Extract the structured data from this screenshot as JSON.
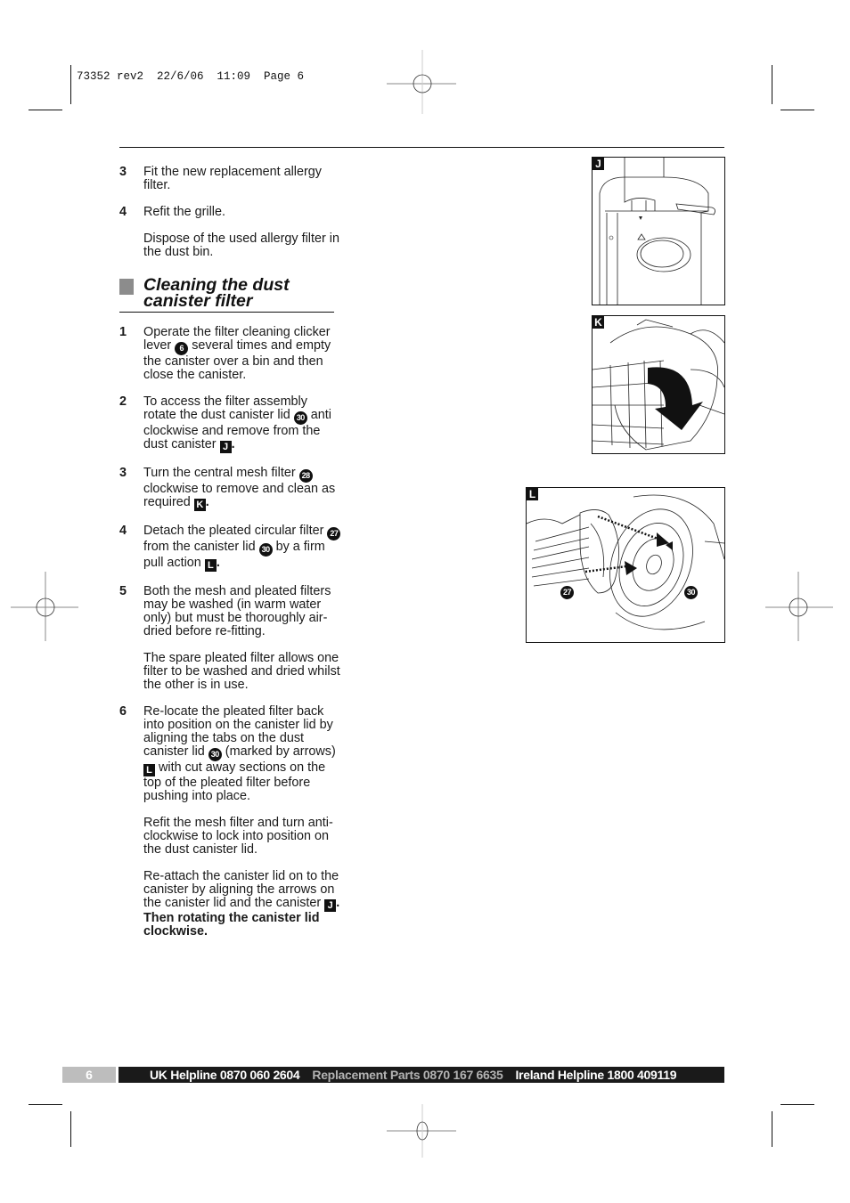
{
  "slug": "73352 rev2  22/6/06  11:09  Page 6",
  "intro_steps": [
    {
      "num": "3",
      "text": "Fit the new replacement allergy filter."
    },
    {
      "num": "4",
      "text": "Refit the grille."
    }
  ],
  "intro_note": "Dispose of the used allergy filter in the dust bin.",
  "section": {
    "heading": "Cleaning the dust canister filter",
    "steps": [
      {
        "num": "1",
        "parts": [
          "Operate the filter cleaning clicker lever ",
          "6",
          " several times and empty the canister over a bin and then close the canister."
        ]
      },
      {
        "num": "2",
        "parts": [
          "To access the filter assembly rotate the dust canister lid ",
          "30",
          " anti clockwise and remove from the dust canister ",
          "J",
          "."
        ]
      },
      {
        "num": "3",
        "parts": [
          "Turn the central mesh filter ",
          "28",
          " clockwise to remove and clean as required ",
          "K",
          "."
        ]
      },
      {
        "num": "4",
        "parts": [
          "Detach the pleated circular filter ",
          "27",
          " from the canister lid ",
          "30",
          " by a firm pull action ",
          "L",
          "."
        ]
      },
      {
        "num": "5",
        "text": "Both the mesh and pleated filters may be washed (in warm water only) but must be thoroughly air-dried before re-fitting."
      },
      {
        "num": "6",
        "parts": [
          "Re-locate the pleated filter back into position on the canister lid by aligning the tabs on the dust canister lid ",
          "30",
          " (marked by arrows) ",
          "L",
          " with cut away sections on the top of the pleated filter before pushing into place."
        ]
      }
    ],
    "note_after_5": "The spare pleated filter allows one filter to be washed and dried whilst the other is in use.",
    "note_after_6a": "Refit the mesh filter and turn anti-clockwise to lock into position on the dust canister lid.",
    "note_after_6b": [
      "Re-attach the canister lid on to the canister by aligning the arrows on the canister lid and the canister ",
      "J",
      ". Then rotating the canister lid clockwise."
    ]
  },
  "figures": {
    "j": {
      "label": "J"
    },
    "k": {
      "label": "K"
    },
    "l": {
      "label": "L",
      "callouts": [
        "27",
        "30"
      ]
    }
  },
  "footer": {
    "page_number": "6",
    "uk_helpline": "UK Helpline 0870 060 2604",
    "replacement_parts": "Replacement Parts 0870 167 6635",
    "ireland_helpline": "Ireland Helpline 1800 409119"
  }
}
